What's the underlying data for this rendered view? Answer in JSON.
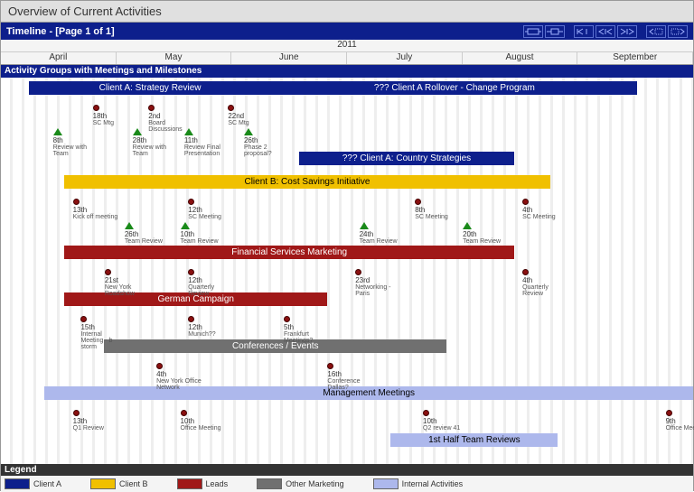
{
  "title": "Overview of Current Activities",
  "timeline_label": "Timeline - [Page 1 of 1]",
  "year": "2011",
  "months": [
    "April",
    "May",
    "June",
    "July",
    "August",
    "September"
  ],
  "section": "Activity Groups with Meetings and Milestones",
  "legend_title": "Legend",
  "legend": [
    {
      "label": "Client A",
      "color": "#0d1f8c"
    },
    {
      "label": "Client B",
      "color": "#f0c000"
    },
    {
      "label": "Leads",
      "color": "#a01818"
    },
    {
      "label": "Other Marketing",
      "color": "#707070"
    },
    {
      "label": "Internal Activities",
      "color": "#adb8ec"
    }
  ],
  "chart_data": {
    "type": "gantt",
    "x_range": [
      "2011-03-25",
      "2011-09-15"
    ],
    "bars": [
      {
        "label": "Client A: Strategy Review",
        "cat": "blue",
        "start": "2011-04-01",
        "end": "2011-06-01",
        "row": 0
      },
      {
        "label": "??? Client A Rollover -  Change Program",
        "cat": "blue",
        "start": "2011-06-01",
        "end": "2011-09-01",
        "row": 0
      },
      {
        "label": "??? Client A: Country Strategies",
        "cat": "blue",
        "start": "2011-06-08",
        "end": "2011-08-01",
        "row": 3
      },
      {
        "label": "Client B: Cost Savings Initiative",
        "cat": "yellow",
        "start": "2011-04-10",
        "end": "2011-08-10",
        "row": 4
      },
      {
        "label": "Financial Services Marketing",
        "cat": "red",
        "start": "2011-04-10",
        "end": "2011-08-01",
        "row": 7
      },
      {
        "label": "German Campaign",
        "cat": "red",
        "start": "2011-04-10",
        "end": "2011-06-15",
        "row": 9
      },
      {
        "label": "Conferences / Events",
        "cat": "gray",
        "start": "2011-04-20",
        "end": "2011-07-15",
        "row": 11
      },
      {
        "label": "Management Meetings",
        "cat": "lav",
        "start": "2011-04-05",
        "end": "2011-09-15",
        "row": 13
      },
      {
        "label": "1st Half Team Reviews",
        "cat": "lav",
        "start": "2011-07-01",
        "end": "2011-08-12",
        "row": 15
      }
    ],
    "milestones": [
      {
        "shape": "dot",
        "date": "18th",
        "label": "SC Mtg",
        "x": "2011-04-18",
        "row": 1
      },
      {
        "shape": "dot",
        "date": "2nd",
        "label": "Board Discussions",
        "x": "2011-05-02",
        "row": 1
      },
      {
        "shape": "dot",
        "date": "22nd",
        "label": "SC Mtg",
        "x": "2011-05-22",
        "row": 1
      },
      {
        "shape": "tri",
        "date": "8th",
        "label": "Review with Team",
        "x": "2011-04-08",
        "row": 2
      },
      {
        "shape": "tri",
        "date": "28th",
        "label": "Review with Team",
        "x": "2011-04-28",
        "row": 2
      },
      {
        "shape": "tri",
        "date": "11th",
        "label": "Review Final Presentation",
        "x": "2011-05-11",
        "row": 2
      },
      {
        "shape": "tri",
        "date": "26th",
        "label": "Phase 2 proposal?",
        "x": "2011-05-26",
        "row": 2
      },
      {
        "shape": "dot",
        "date": "13th",
        "label": "Kick off meeting",
        "x": "2011-04-13",
        "row": 5
      },
      {
        "shape": "dot",
        "date": "12th",
        "label": "SC Meeting",
        "x": "2011-05-12",
        "row": 5
      },
      {
        "shape": "dot",
        "date": "8th",
        "label": "SC Meeting",
        "x": "2011-07-08",
        "row": 5
      },
      {
        "shape": "dot",
        "date": "4th",
        "label": "SC Meeting",
        "x": "2011-08-04",
        "row": 5
      },
      {
        "shape": "tri",
        "date": "26th",
        "label": "Team Review",
        "x": "2011-04-26",
        "row": 6
      },
      {
        "shape": "tri",
        "date": "10th",
        "label": "Team Review",
        "x": "2011-05-10",
        "row": 6
      },
      {
        "shape": "tri",
        "date": "24th",
        "label": "Team Review",
        "x": "2011-06-24",
        "row": 6
      },
      {
        "shape": "tri",
        "date": "20th",
        "label": "Team Review",
        "x": "2011-07-20",
        "row": 6
      },
      {
        "shape": "dot",
        "date": "21st",
        "label": "New York Roadshow",
        "x": "2011-04-21",
        "row": 8
      },
      {
        "shape": "dot",
        "date": "12th",
        "label": "Quarterly Review",
        "x": "2011-05-12",
        "row": 8
      },
      {
        "shape": "dot",
        "date": "23rd",
        "label": "Networking - Paris",
        "x": "2011-06-23",
        "row": 8
      },
      {
        "shape": "dot",
        "date": "4th",
        "label": "Quarterly Review",
        "x": "2011-08-04",
        "row": 8
      },
      {
        "shape": "dot",
        "date": "15th",
        "label": "Internal Meeting - b storm",
        "x": "2011-04-15",
        "row": 10
      },
      {
        "shape": "dot",
        "date": "12th",
        "label": "Munich??",
        "x": "2011-05-12",
        "row": 10
      },
      {
        "shape": "dot",
        "date": "5th",
        "label": "Frankfurt Meetings?",
        "x": "2011-06-05",
        "row": 10
      },
      {
        "shape": "dot",
        "date": "4th",
        "label": "New York Office Network",
        "x": "2011-05-04",
        "row": 12
      },
      {
        "shape": "dot",
        "date": "16th",
        "label": "Conference Dallas?",
        "x": "2011-06-16",
        "row": 12
      },
      {
        "shape": "dot",
        "date": "13th",
        "label": "Q1 Review",
        "x": "2011-04-13",
        "row": 14
      },
      {
        "shape": "dot",
        "date": "10th",
        "label": "Office Meeting",
        "x": "2011-05-10",
        "row": 14
      },
      {
        "shape": "dot",
        "date": "10th",
        "label": "Q2 review 41",
        "x": "2011-07-10",
        "row": 14
      },
      {
        "shape": "dot",
        "date": "9th",
        "label": "Office Meeting",
        "x": "2011-09-09",
        "row": 14
      }
    ]
  }
}
